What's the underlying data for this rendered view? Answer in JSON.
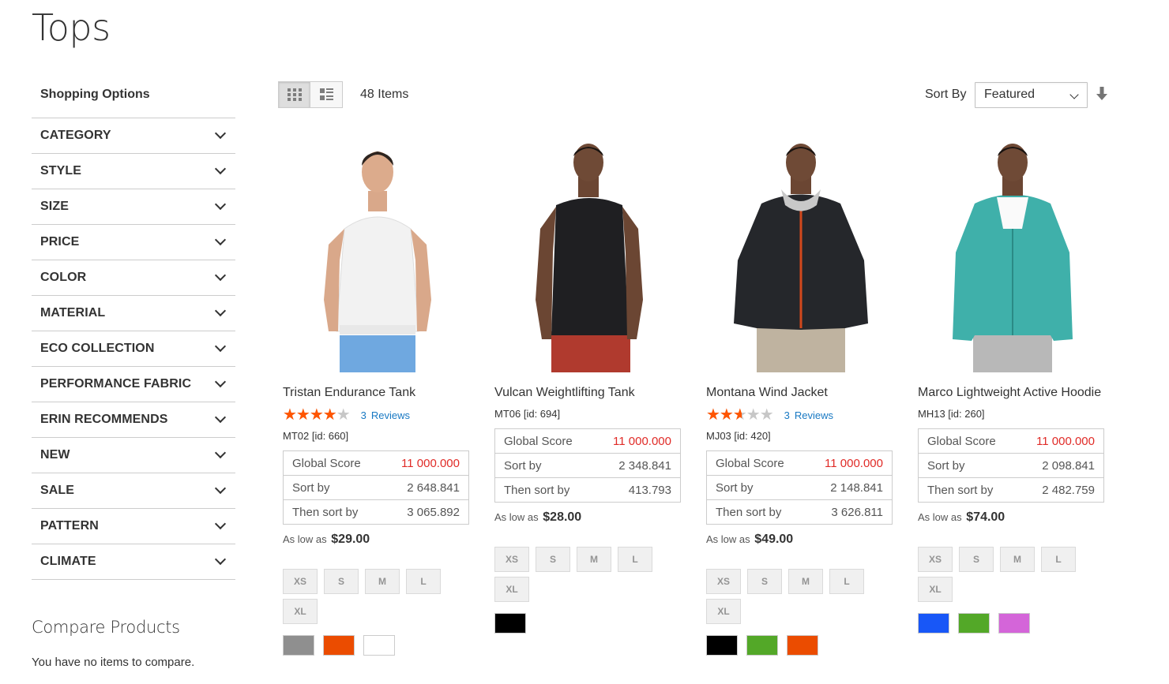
{
  "page": {
    "title": "Tops"
  },
  "sidebar": {
    "heading": "Shopping Options",
    "filters": [
      "CATEGORY",
      "STYLE",
      "SIZE",
      "PRICE",
      "COLOR",
      "MATERIAL",
      "ECO COLLECTION",
      "PERFORMANCE FABRIC",
      "ERIN RECOMMENDS",
      "NEW",
      "SALE",
      "PATTERN",
      "CLIMATE"
    ],
    "compare": {
      "title": "Compare Products",
      "empty": "You have no items to compare."
    }
  },
  "toolbar": {
    "grid_icon": "grid-icon",
    "list_icon": "list-icon",
    "items_count": "48 Items",
    "sort_label": "Sort By",
    "sort_value": "Featured",
    "sort_direction_icon": "arrow-down-icon"
  },
  "score_labels": {
    "global": "Global Score",
    "sort": "Sort by",
    "then": "Then sort by"
  },
  "price_prefix": "As low as",
  "products": [
    {
      "name": "Tristan Endurance Tank",
      "rating": 0.8,
      "reviews_count": "3",
      "reviews_label": "Reviews",
      "sku": "MT02 [id: 660]",
      "scores": {
        "global": "11 000.000",
        "sort": "2 648.841",
        "then": "3 065.892"
      },
      "price": "$29.00",
      "sizes": [
        "XS",
        "S",
        "M",
        "L",
        "XL"
      ],
      "colors": [
        "#8f8f8f",
        "#eb4c00",
        "#ffffff"
      ]
    },
    {
      "name": "Vulcan Weightlifting Tank",
      "rating": null,
      "reviews_count": "",
      "reviews_label": "",
      "sku": "MT06 [id: 694]",
      "scores": {
        "global": "11 000.000",
        "sort": "2 348.841",
        "then": "413.793"
      },
      "price": "$28.00",
      "sizes": [
        "XS",
        "S",
        "M",
        "L",
        "XL"
      ],
      "colors": [
        "#000000"
      ]
    },
    {
      "name": "Montana Wind Jacket",
      "rating": 0.53,
      "reviews_count": "3",
      "reviews_label": "Reviews",
      "sku": "MJ03 [id: 420]",
      "scores": {
        "global": "11 000.000",
        "sort": "2 148.841",
        "then": "3 626.811"
      },
      "price": "$49.00",
      "sizes": [
        "XS",
        "S",
        "M",
        "L",
        "XL"
      ],
      "colors": [
        "#000000",
        "#53a828",
        "#eb4c00"
      ]
    },
    {
      "name": "Marco Lightweight Active Hoodie",
      "rating": null,
      "reviews_count": "",
      "reviews_label": "",
      "sku": "MH13 [id: 260]",
      "scores": {
        "global": "11 000.000",
        "sort": "2 098.841",
        "then": "2 482.759"
      },
      "price": "$74.00",
      "sizes": [
        "XS",
        "S",
        "M",
        "L",
        "XL"
      ],
      "colors": [
        "#1857f7",
        "#53a828",
        "#d465d9"
      ]
    }
  ]
}
